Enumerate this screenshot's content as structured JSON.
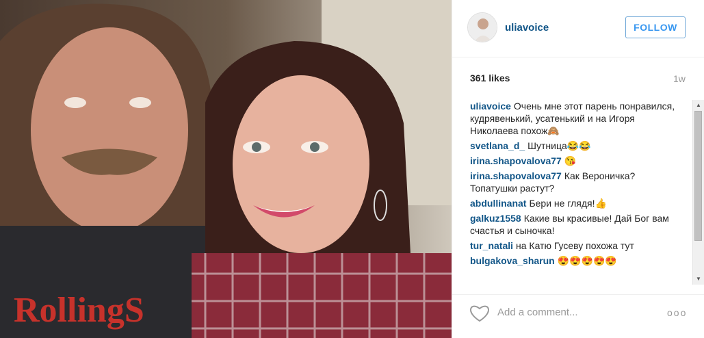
{
  "post": {
    "username": "uliavoice",
    "follow_label": "FOLLOW",
    "likes": "361 likes",
    "age": "1w",
    "add_comment_placeholder": "Add a comment...",
    "more_label": "ooo"
  },
  "comments": [
    {
      "user": "uliavoice",
      "text": "Очень мне этот парень понравился, кудрявенький, усатенький и на Игоря Николаева похож🙈"
    },
    {
      "user": "svetlana_d_",
      "text": "Шутница😂😂"
    },
    {
      "user": "irina.shapovalova77",
      "text": "😘"
    },
    {
      "user": "irina.shapovalova77",
      "text": "Как Вероничка? Топатушки растут?"
    },
    {
      "user": "abdullinanat",
      "text": "Бери не глядя!👍"
    },
    {
      "user": "galkuz1558",
      "text": "Какие вы красивые! Дай Бог вам счастья и сыночка!"
    },
    {
      "user": "tur_natali",
      "text": "на Катю Гусеву похожа тут"
    },
    {
      "user": "bulgakova_sharun",
      "text": "😍😍😍😍😍"
    }
  ],
  "photo": {
    "shirt_text": "RollingS"
  }
}
